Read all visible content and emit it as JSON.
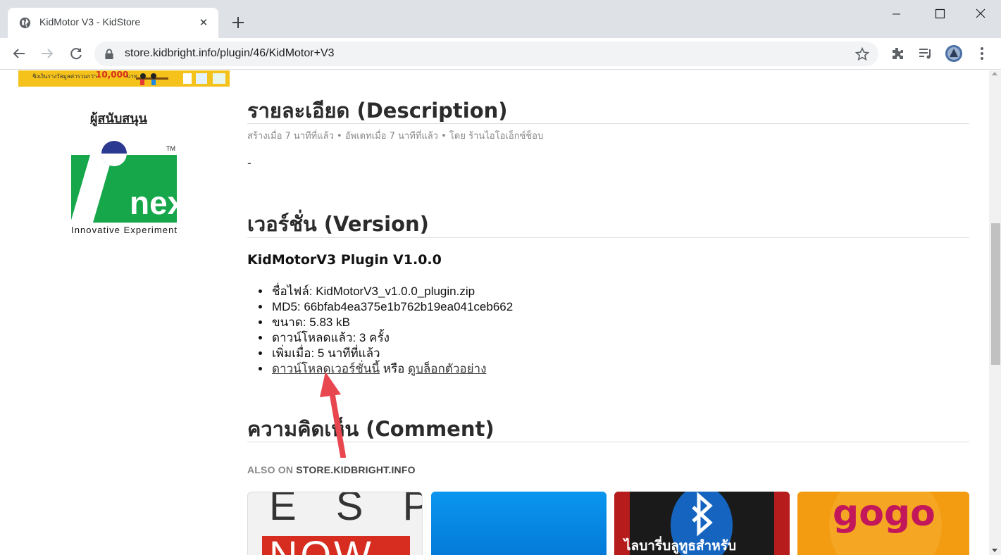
{
  "browser": {
    "tab_title": "KidMotor V3 - KidStore",
    "close_glyph": "✕",
    "url": "store.kidbright.info/plugin/46/KidMotor+V3"
  },
  "sidebar": {
    "banner_text": "ชิงเงินรางวัลมูลค่ารวมกว่า",
    "banner_amount": "10,000",
    "banner_unit": "บาท",
    "sponsor_title": "ผู้สนับสนุน",
    "logo_tagline": "Innovative Experiment",
    "logo_wordmark": "nex",
    "logo_tm": "TM"
  },
  "description": {
    "heading": "รายละเอียด (Description)",
    "meta": "สร้างเมื่อ 7 นาทีที่แล้ว • อัพเดทเมื่อ 7 นาทีที่แล้ว • โดย ร้านไอโอเอ็กซ์ช็อบ",
    "body": "-"
  },
  "version": {
    "heading": "เวอร์ชั่น (Version)",
    "title": "KidMotorV3 Plugin V1.0.0",
    "filename": "ชื่อไฟล์: KidMotorV3_v1.0.0_plugin.zip",
    "md5": "MD5: 66bfab4ea375e1b762b19ea041ceb662",
    "size": "ขนาด: 5.83 kB",
    "downloads": "ดาวน์โหลดแล้ว: 3 ครั้ง",
    "added": "เพิ่มเมื่อ: 5 นาทีที่แล้ว",
    "download_link": "ดาวน์โหลดเวอร์ชั่นนี้",
    "or": "หรือ",
    "example_link": "ดูบล็อกตัวอย่าง"
  },
  "comment": {
    "heading": "ความคิดเห็น (Comment)",
    "also_on": "ALSO ON",
    "site": "STORE.KIDBRIGHT.INFO",
    "cards": [
      {
        "top_text": "E S P",
        "bottom_text": "NOW"
      },
      {
        "caption": ""
      },
      {
        "caption": "ไลบารี่บลูทูธสำหรับ"
      },
      {
        "logo_text": "gogo"
      }
    ]
  },
  "colors": {
    "annotation_arrow": "#e8474f",
    "banner": "#f5c21b",
    "inex_green": "#15a74a",
    "inex_blue": "#2b3990"
  }
}
